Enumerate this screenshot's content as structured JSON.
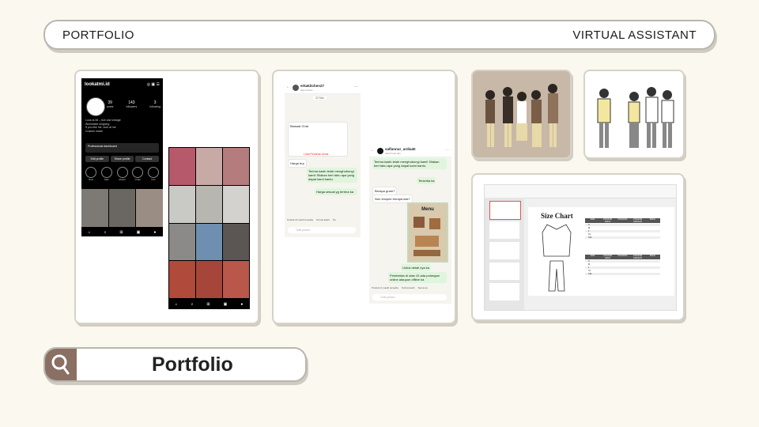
{
  "header": {
    "left_title": "PORTFOLIO",
    "right_title": "VIRTUAL ASSISTANT"
  },
  "search": {
    "label": "Portfolio"
  },
  "instagram": {
    "username": "lookatmi.id",
    "stats": [
      {
        "value": "39",
        "label": "posts"
      },
      {
        "value": "143",
        "label": "followers"
      },
      {
        "value": "3",
        "label": "following"
      }
    ],
    "bio": [
      "Look at MI – tice and vintage",
      "Worldwide shipping",
      "If you like me, look at me",
      "Custom made"
    ],
    "dashboard_title": "Professional dashboard",
    "buttons": [
      "Edit profile",
      "Share profile",
      "Contact"
    ],
    "highlights": [
      "New",
      "Sale",
      "Model",
      "Order",
      "Info"
    ]
  },
  "chat1": {
    "name": "erkakitchen27",
    "status": "Akun bisnis",
    "date": "22 Mar",
    "messages": [
      {
        "dir": "in",
        "text": "Biasaat Chat"
      },
      {
        "dir": "in",
        "text": "Harga brp"
      },
      {
        "dir": "out",
        "text": "Terima kasih telah menghubungi kami! Silakan beri tahu apa yang dapat kami bantu."
      },
      {
        "dir": "out",
        "text": "Harga sesuai yg tertera ka"
      }
    ],
    "link": "Lihat Pesanan Anda",
    "footer": [
      "Produk di masih tersedia",
      "Terima kasih",
      "Ter"
    ],
    "input_placeholder": "Tulis pesan..."
  },
  "chat2": {
    "name": "salfannur_ardia40",
    "status": "Aktif 8 hari lalu",
    "messages": [
      {
        "dir": "out",
        "text": "Terima kasih telah menghubungi kami! Silakan beri tahu apa yang dapat kami bantu."
      },
      {
        "dir": "out",
        "text": "Tersedia ka"
      },
      {
        "dir": "in",
        "text": "Berapa gram?"
      },
      {
        "dir": "in",
        "text": "Non shopee berapa kak?"
      },
      {
        "dir": "out",
        "text": "Untuk detail nya ka"
      },
      {
        "dir": "out",
        "text": "Pembelian di atas 10 ada potongan online ataupun offline ka"
      }
    ],
    "menu_title": "Menu",
    "footer": [
      "Produk ini masih tersedia",
      "Terima kasih",
      "Sama-sa"
    ],
    "input_placeholder": "Tulis pesan..."
  },
  "size_chart": {
    "title": "Size Chart",
    "table_headers": [
      "SIZE",
      "LINGKAR DADA",
      "PANJANG",
      "LINGKAR LENGAN",
      "BAHU"
    ],
    "sizes": [
      "S",
      "M",
      "L",
      "XL",
      "XXL"
    ]
  },
  "colors": {
    "accent": "#8a6f63",
    "card_border": "#d7d2c7",
    "background": "#fbf8ef",
    "chat_green": "#dff6dc",
    "illus_bg": "#c7b8a8"
  }
}
